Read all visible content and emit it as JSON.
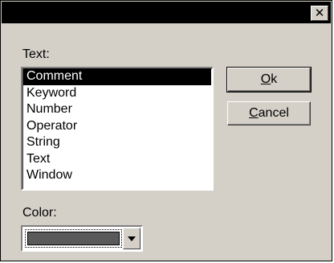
{
  "window": {
    "close_glyph": "✕"
  },
  "text_section": {
    "label": "Text:",
    "items": [
      "Comment",
      "Keyword",
      "Number",
      "Operator",
      "String",
      "Text",
      "Window"
    ],
    "selected": "Comment"
  },
  "buttons": {
    "ok_mnemonic": "O",
    "ok_rest": "k",
    "cancel_mnemonic": "C",
    "cancel_rest": "ancel"
  },
  "color_section": {
    "label": "Color:",
    "selected_color": "#5a5a5a"
  }
}
